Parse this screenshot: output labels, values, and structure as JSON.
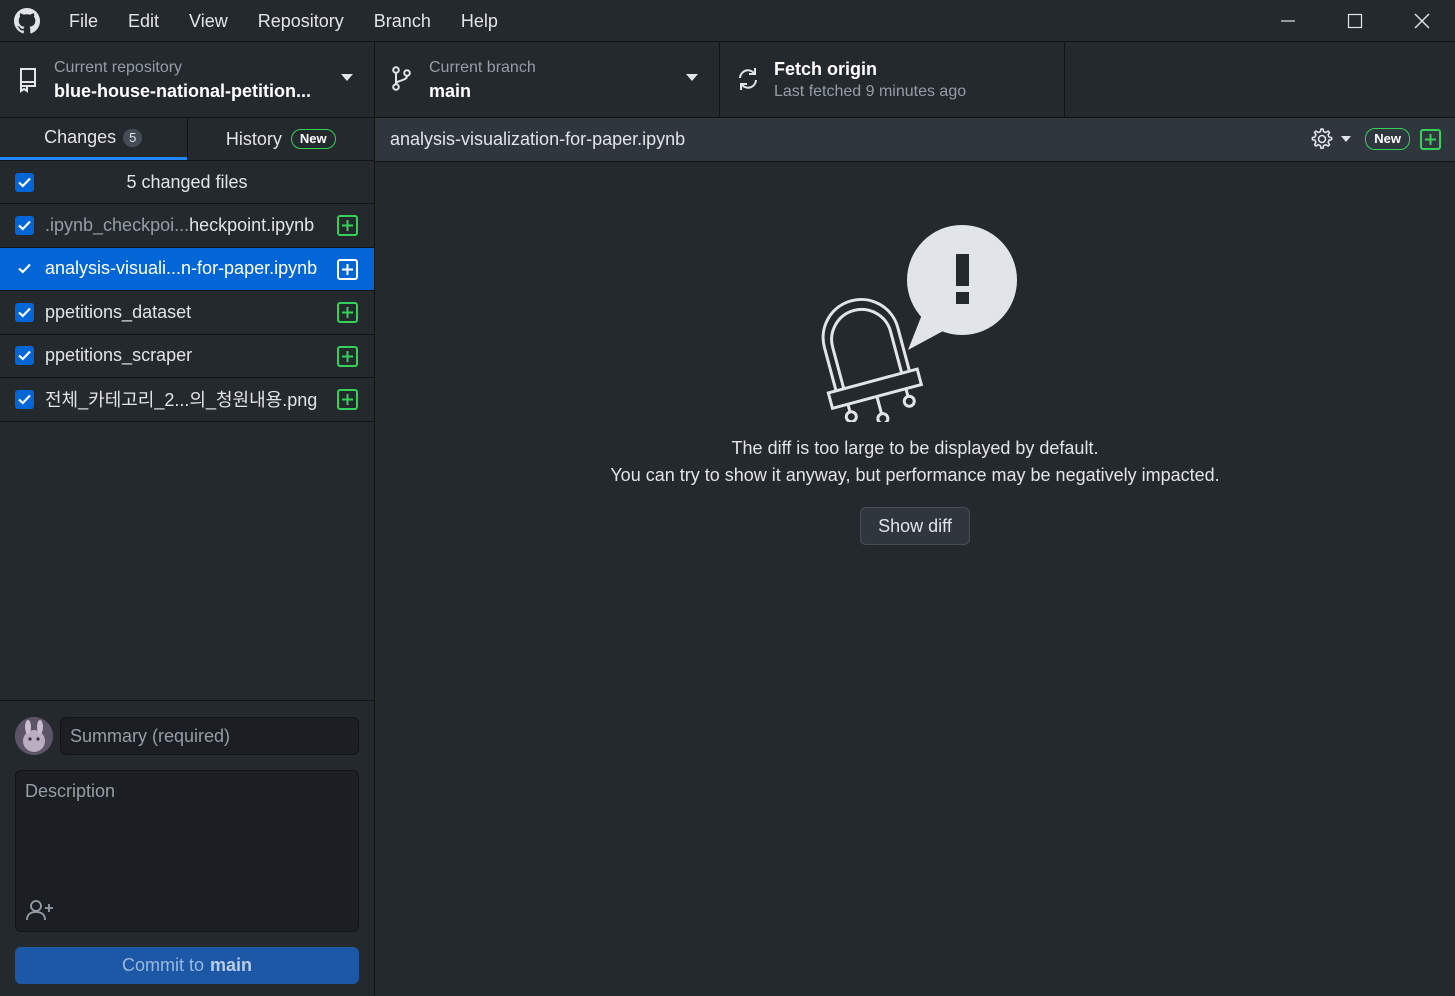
{
  "menu": [
    "File",
    "Edit",
    "View",
    "Repository",
    "Branch",
    "Help"
  ],
  "toolbar": {
    "repo_label": "Current repository",
    "repo_value": "blue-house-national-petition...",
    "branch_label": "Current branch",
    "branch_value": "main",
    "fetch_label": "Fetch origin",
    "fetch_status": "Last fetched 9 minutes ago"
  },
  "tabs": {
    "changes_label": "Changes",
    "changes_count": "5",
    "history_label": "History",
    "history_badge": "New"
  },
  "changes": {
    "header": "5 changed files",
    "files": [
      {
        "dim": ".ipynb_checkpoi...",
        "rest": "heckpoint.ipynb",
        "status": "added",
        "checked": true,
        "selected": false
      },
      {
        "dim": "",
        "rest": "analysis-visuali...n-for-paper.ipynb",
        "status": "added",
        "checked": true,
        "selected": true
      },
      {
        "dim": "",
        "rest": "ppetitions_dataset",
        "status": "added",
        "checked": true,
        "selected": false
      },
      {
        "dim": "",
        "rest": "ppetitions_scraper",
        "status": "added",
        "checked": true,
        "selected": false
      },
      {
        "dim": "",
        "rest": "전체_카테고리_2...의_청원내용.png",
        "status": "added",
        "checked": true,
        "selected": false
      }
    ]
  },
  "commit": {
    "summary_placeholder": "Summary (required)",
    "description_placeholder": "Description",
    "button_prefix": "Commit to",
    "button_branch": "main"
  },
  "diff": {
    "file_title": "analysis-visualization-for-paper.ipynb",
    "new_badge": "New",
    "message_line1": "The diff is too large to be displayed by default.",
    "message_line2": "You can try to show it anyway, but performance may be negatively impacted.",
    "show_diff_label": "Show diff"
  },
  "colors": {
    "accent": "#0366d6",
    "added": "#34d058",
    "background": "#24292e"
  }
}
